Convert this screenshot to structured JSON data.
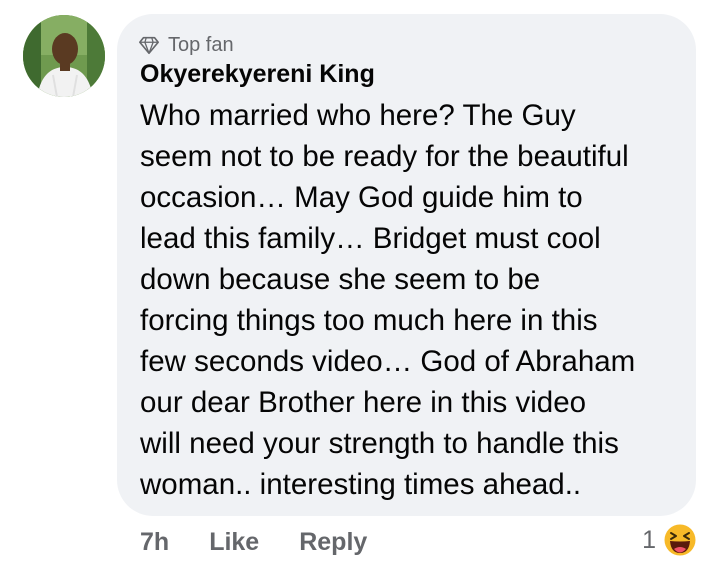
{
  "comment": {
    "badge_label": "Top fan",
    "author": "Okyerekyereni King",
    "text_lines": [
      "Who married who here? The Guy",
      "seem not to be ready for the beautiful",
      "occasion… May God guide him to",
      "lead this family… Bridget must cool",
      "down because she seem to be",
      "forcing things too much here in this",
      "few seconds video… God of Abraham",
      "our dear Brother here in this video",
      "will need your strength to handle this",
      "woman.. interesting times ahead.."
    ]
  },
  "actions": {
    "time": "7h",
    "like_label": "Like",
    "reply_label": "Reply"
  },
  "reactions": {
    "count": "1",
    "icon": "haha-laugh-emoji-icon"
  },
  "colors": {
    "bubble_bg": "#f0f2f5",
    "text": "#050505",
    "secondary_text": "#65676b",
    "reaction_yellow": "#f7b928"
  }
}
